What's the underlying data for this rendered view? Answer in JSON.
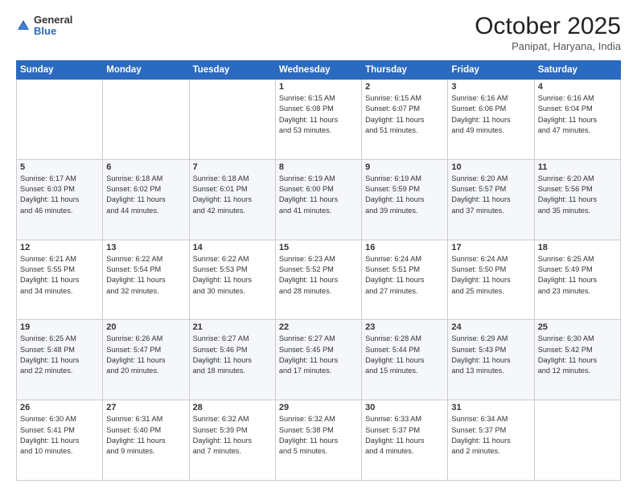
{
  "logo": {
    "general": "General",
    "blue": "Blue"
  },
  "header": {
    "month": "October 2025",
    "location": "Panipat, Haryana, India"
  },
  "days_of_week": [
    "Sunday",
    "Monday",
    "Tuesday",
    "Wednesday",
    "Thursday",
    "Friday",
    "Saturday"
  ],
  "weeks": [
    [
      {
        "day": "",
        "info": ""
      },
      {
        "day": "",
        "info": ""
      },
      {
        "day": "",
        "info": ""
      },
      {
        "day": "1",
        "info": "Sunrise: 6:15 AM\nSunset: 6:08 PM\nDaylight: 11 hours\nand 53 minutes."
      },
      {
        "day": "2",
        "info": "Sunrise: 6:15 AM\nSunset: 6:07 PM\nDaylight: 11 hours\nand 51 minutes."
      },
      {
        "day": "3",
        "info": "Sunrise: 6:16 AM\nSunset: 6:06 PM\nDaylight: 11 hours\nand 49 minutes."
      },
      {
        "day": "4",
        "info": "Sunrise: 6:16 AM\nSunset: 6:04 PM\nDaylight: 11 hours\nand 47 minutes."
      }
    ],
    [
      {
        "day": "5",
        "info": "Sunrise: 6:17 AM\nSunset: 6:03 PM\nDaylight: 11 hours\nand 46 minutes."
      },
      {
        "day": "6",
        "info": "Sunrise: 6:18 AM\nSunset: 6:02 PM\nDaylight: 11 hours\nand 44 minutes."
      },
      {
        "day": "7",
        "info": "Sunrise: 6:18 AM\nSunset: 6:01 PM\nDaylight: 11 hours\nand 42 minutes."
      },
      {
        "day": "8",
        "info": "Sunrise: 6:19 AM\nSunset: 6:00 PM\nDaylight: 11 hours\nand 41 minutes."
      },
      {
        "day": "9",
        "info": "Sunrise: 6:19 AM\nSunset: 5:59 PM\nDaylight: 11 hours\nand 39 minutes."
      },
      {
        "day": "10",
        "info": "Sunrise: 6:20 AM\nSunset: 5:57 PM\nDaylight: 11 hours\nand 37 minutes."
      },
      {
        "day": "11",
        "info": "Sunrise: 6:20 AM\nSunset: 5:56 PM\nDaylight: 11 hours\nand 35 minutes."
      }
    ],
    [
      {
        "day": "12",
        "info": "Sunrise: 6:21 AM\nSunset: 5:55 PM\nDaylight: 11 hours\nand 34 minutes."
      },
      {
        "day": "13",
        "info": "Sunrise: 6:22 AM\nSunset: 5:54 PM\nDaylight: 11 hours\nand 32 minutes."
      },
      {
        "day": "14",
        "info": "Sunrise: 6:22 AM\nSunset: 5:53 PM\nDaylight: 11 hours\nand 30 minutes."
      },
      {
        "day": "15",
        "info": "Sunrise: 6:23 AM\nSunset: 5:52 PM\nDaylight: 11 hours\nand 28 minutes."
      },
      {
        "day": "16",
        "info": "Sunrise: 6:24 AM\nSunset: 5:51 PM\nDaylight: 11 hours\nand 27 minutes."
      },
      {
        "day": "17",
        "info": "Sunrise: 6:24 AM\nSunset: 5:50 PM\nDaylight: 11 hours\nand 25 minutes."
      },
      {
        "day": "18",
        "info": "Sunrise: 6:25 AM\nSunset: 5:49 PM\nDaylight: 11 hours\nand 23 minutes."
      }
    ],
    [
      {
        "day": "19",
        "info": "Sunrise: 6:25 AM\nSunset: 5:48 PM\nDaylight: 11 hours\nand 22 minutes."
      },
      {
        "day": "20",
        "info": "Sunrise: 6:26 AM\nSunset: 5:47 PM\nDaylight: 11 hours\nand 20 minutes."
      },
      {
        "day": "21",
        "info": "Sunrise: 6:27 AM\nSunset: 5:46 PM\nDaylight: 11 hours\nand 18 minutes."
      },
      {
        "day": "22",
        "info": "Sunrise: 6:27 AM\nSunset: 5:45 PM\nDaylight: 11 hours\nand 17 minutes."
      },
      {
        "day": "23",
        "info": "Sunrise: 6:28 AM\nSunset: 5:44 PM\nDaylight: 11 hours\nand 15 minutes."
      },
      {
        "day": "24",
        "info": "Sunrise: 6:29 AM\nSunset: 5:43 PM\nDaylight: 11 hours\nand 13 minutes."
      },
      {
        "day": "25",
        "info": "Sunrise: 6:30 AM\nSunset: 5:42 PM\nDaylight: 11 hours\nand 12 minutes."
      }
    ],
    [
      {
        "day": "26",
        "info": "Sunrise: 6:30 AM\nSunset: 5:41 PM\nDaylight: 11 hours\nand 10 minutes."
      },
      {
        "day": "27",
        "info": "Sunrise: 6:31 AM\nSunset: 5:40 PM\nDaylight: 11 hours\nand 9 minutes."
      },
      {
        "day": "28",
        "info": "Sunrise: 6:32 AM\nSunset: 5:39 PM\nDaylight: 11 hours\nand 7 minutes."
      },
      {
        "day": "29",
        "info": "Sunrise: 6:32 AM\nSunset: 5:38 PM\nDaylight: 11 hours\nand 5 minutes."
      },
      {
        "day": "30",
        "info": "Sunrise: 6:33 AM\nSunset: 5:37 PM\nDaylight: 11 hours\nand 4 minutes."
      },
      {
        "day": "31",
        "info": "Sunrise: 6:34 AM\nSunset: 5:37 PM\nDaylight: 11 hours\nand 2 minutes."
      },
      {
        "day": "",
        "info": ""
      }
    ]
  ]
}
